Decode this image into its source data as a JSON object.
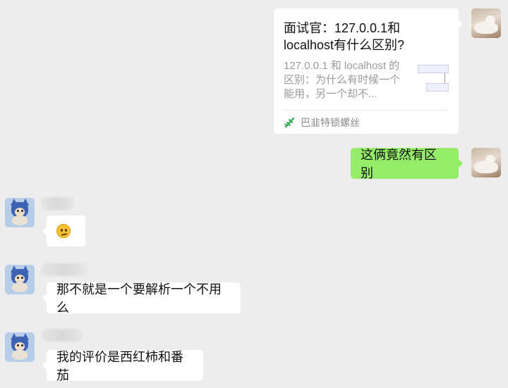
{
  "messages": {
    "shared_card": {
      "title": "面试官：127.0.0.1和localhost有什么区别?",
      "description": "127.0.0.1 和 localhost 的区别：为什么有时候一个能用，另一个却不...",
      "source": "巴韭特锁螺丝",
      "source_icon": "bamboo-icon"
    },
    "my_reply": "这俩竟然有区别",
    "other_1": {
      "emoji": "confused-face-emoji"
    },
    "other_2": "那不就是一个要解析一个不用么",
    "other_3": "我的评价是西红柿和番茄"
  },
  "colors": {
    "background": "#ededed",
    "my_bubble": "#95ec69",
    "other_bubble": "#ffffff",
    "source_icon": "#3aa655"
  }
}
